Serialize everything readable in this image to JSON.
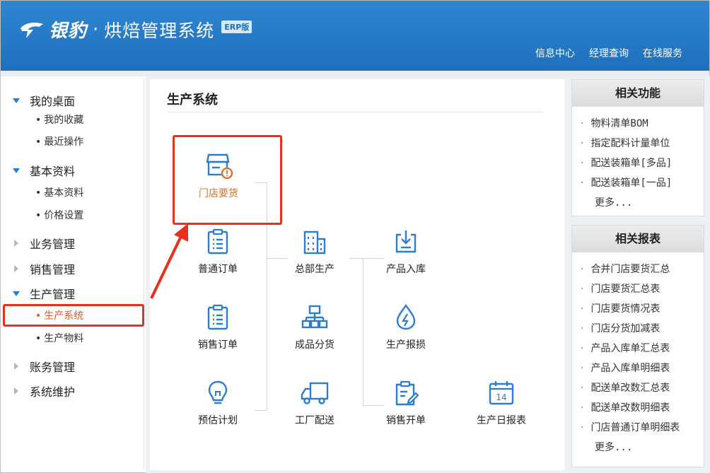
{
  "header": {
    "brand": "银豹",
    "separator": "·",
    "system_title": "烘焙管理系统",
    "edition_badge": "ERP版",
    "links": [
      "信息中心",
      "经理查询",
      "在线服务"
    ]
  },
  "sidebar": {
    "groups": [
      {
        "label": "我的桌面",
        "expanded": true,
        "items": [
          "我的收藏",
          "最近操作"
        ]
      },
      {
        "label": "基本资料",
        "expanded": true,
        "items": [
          "基本资料",
          "价格设置"
        ]
      },
      {
        "label": "业务管理",
        "expanded": false,
        "items": []
      },
      {
        "label": "销售管理",
        "expanded": false,
        "items": []
      },
      {
        "label": "生产管理",
        "expanded": true,
        "items": [
          "生产系统",
          "生产物料"
        ]
      },
      {
        "label": "账务管理",
        "expanded": false,
        "items": []
      },
      {
        "label": "系统维护",
        "expanded": false,
        "items": []
      }
    ],
    "active_item": "生产系统"
  },
  "main": {
    "title": "生产系统",
    "tiles": {
      "store_order": {
        "label": "门店要货",
        "icon": "store-alert-icon"
      },
      "normal_order": {
        "label": "普通订单",
        "icon": "clipboard-list-icon"
      },
      "sales_order": {
        "label": "销售订单",
        "icon": "clipboard-list-icon"
      },
      "forecast": {
        "label": "预估计划",
        "icon": "lightbulb-icon"
      },
      "hq_production": {
        "label": "总部生产",
        "icon": "building-icon"
      },
      "product_dist": {
        "label": "成品分货",
        "icon": "hierarchy-icon"
      },
      "factory_delivery": {
        "label": "工厂配送",
        "icon": "truck-icon"
      },
      "product_stock_in": {
        "label": "产品入库",
        "icon": "tray-download-icon"
      },
      "production_loss": {
        "label": "生产报损",
        "icon": "water-bolt-icon"
      },
      "sales_bill": {
        "label": "销售开单",
        "icon": "clipboard-edit-icon"
      },
      "daily_report": {
        "label": "生产日报表",
        "icon": "calendar-14-icon",
        "calendar_number": "14"
      }
    }
  },
  "right_panel": {
    "functions": {
      "title": "相关功能",
      "items": [
        "物料清单BOM",
        "指定配料计量单位",
        "配送装箱单[多品]",
        "配送装箱单[一品]"
      ],
      "more": "更多..."
    },
    "reports": {
      "title": "相关报表",
      "items": [
        "合并门店要货汇总",
        "门店要货汇总表",
        "门店要货情况表",
        "门店分货加减表",
        "产品入库单汇总表",
        "产品入库单明细表",
        "配送单改数汇总表",
        "配送单改数明细表",
        "门店普通订单明细表"
      ],
      "more": "更多..."
    }
  },
  "colors": {
    "header_blue": "#2a7fcc",
    "accent_blue": "#2c7dd0",
    "highlight_red": "#e8301c",
    "active_orange": "#e05a2a"
  }
}
